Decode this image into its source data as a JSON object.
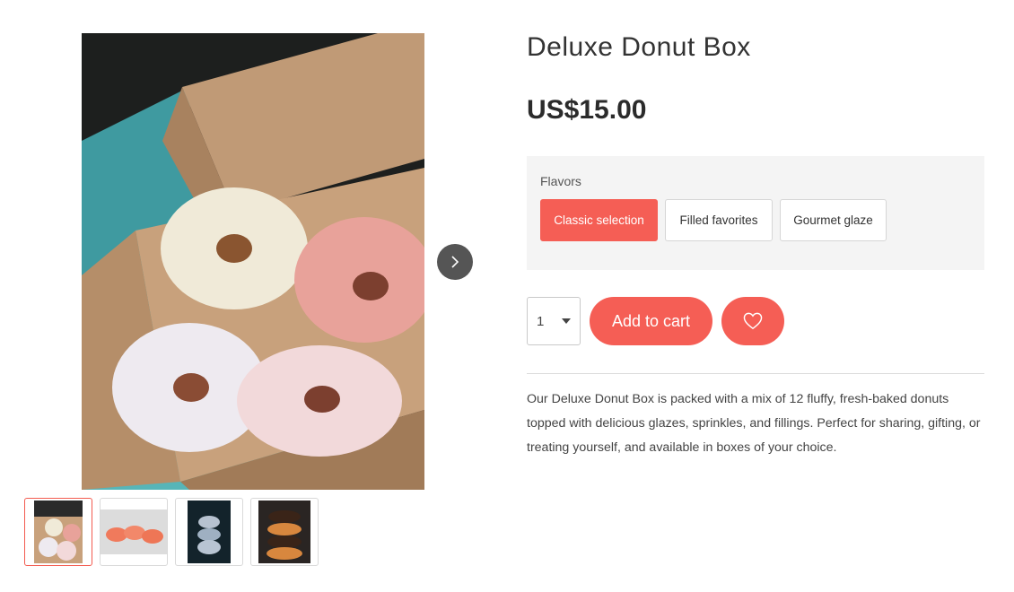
{
  "product": {
    "title": "Deluxe Donut Box",
    "price": "US$15.00",
    "description": "Our Deluxe Donut Box is packed with a mix of 12 fluffy, fresh-baked donuts topped with delicious glazes, sprinkles, and fillings. Perfect for sharing, gifting, or treating yourself, and available in boxes of your choice."
  },
  "options": {
    "label": "Flavors",
    "choices": [
      {
        "label": "Classic selection",
        "selected": true
      },
      {
        "label": "Filled favorites",
        "selected": false
      },
      {
        "label": "Gourmet glaze",
        "selected": false
      }
    ]
  },
  "purchase": {
    "quantity": "1",
    "add_to_cart_label": "Add to cart"
  },
  "gallery": {
    "thumbnail_count": 4,
    "active_index": 0
  },
  "icons": {
    "next": "chevron-right-icon",
    "quantity_dropdown": "caret-down-icon",
    "wishlist": "heart-icon"
  },
  "colors": {
    "accent": "#f55e55",
    "options_bg": "#f4f4f4",
    "arrow_bg": "#555555"
  }
}
